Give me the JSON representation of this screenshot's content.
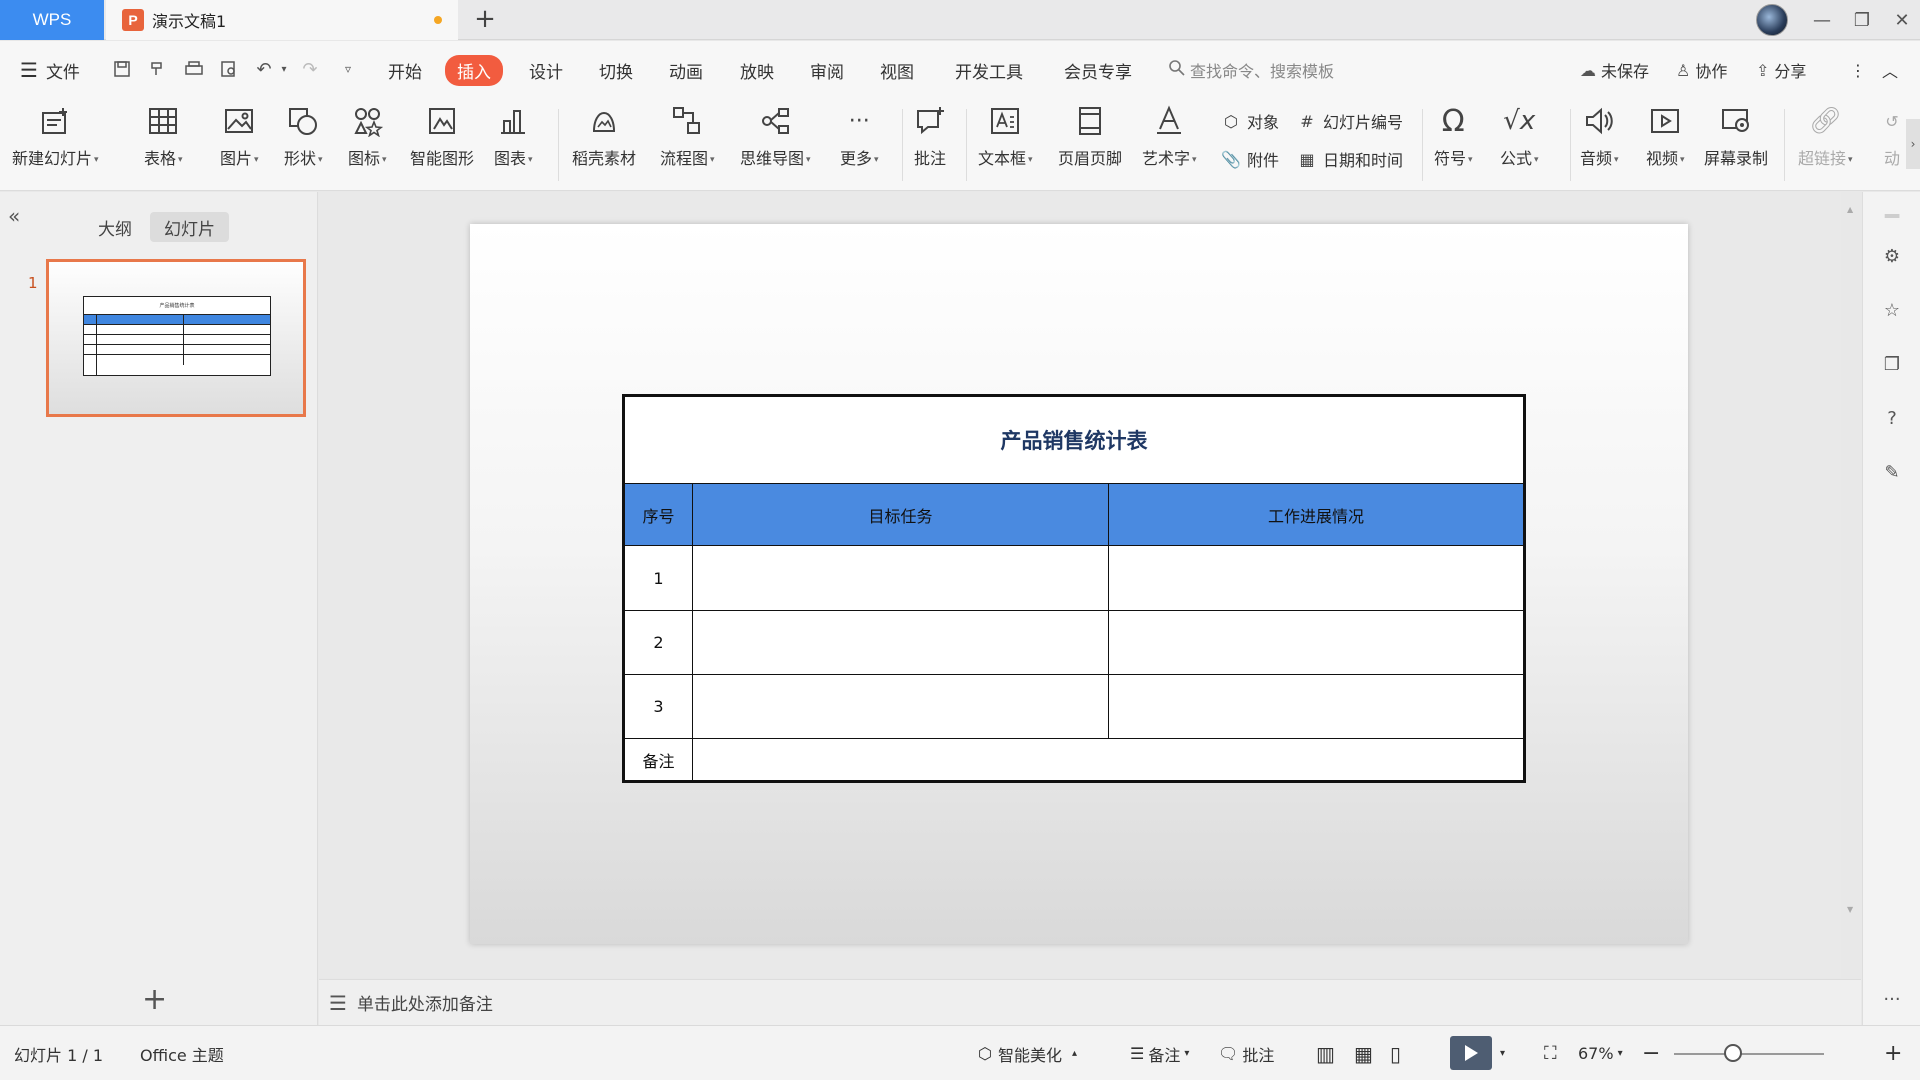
{
  "titlebar": {
    "app_label": "WPS",
    "doc_icon_letter": "P",
    "doc_title": "演示文稿1",
    "new_tab": "+"
  },
  "menu": {
    "file": "文件",
    "tabs": [
      "开始",
      "插入",
      "设计",
      "切换",
      "动画",
      "放映",
      "审阅",
      "视图",
      "开发工具",
      "会员专享"
    ],
    "active_tab": "插入",
    "search_placeholder": "查找命令、搜索模板",
    "unsaved": "未保存",
    "collab": "协作",
    "share": "分享"
  },
  "ribbon": {
    "new_slide": "新建幻灯片",
    "table": "表格",
    "picture": "图片",
    "shape": "形状",
    "icon": "图标",
    "smartart": "智能图形",
    "chart": "图表",
    "docer": "稻壳素材",
    "flowchart": "流程图",
    "mindmap": "思维导图",
    "more": "更多",
    "comment": "批注",
    "textbox": "文本框",
    "header_footer": "页眉页脚",
    "wordart": "艺术字",
    "object": "对象",
    "attachment": "附件",
    "slide_number": "幻灯片编号",
    "datetime": "日期和时间",
    "symbol": "符号",
    "formula": "公式",
    "audio": "音频",
    "video": "视频",
    "screen_record": "屏幕录制",
    "hyperlink": "超链接",
    "action": "动"
  },
  "left_panel": {
    "tab_outline": "大纲",
    "tab_slides": "幻灯片",
    "slide_number": "1",
    "thumb_title": "产品销售统计表",
    "add": "+"
  },
  "slide": {
    "table_title": "产品销售统计表",
    "headers": [
      "序号",
      "目标任务",
      "工作进展情况"
    ],
    "rows": [
      "1",
      "2",
      "3"
    ],
    "remark": "备注",
    "header_color": "#4a8ae0"
  },
  "notes": {
    "placeholder": "单击此处添加备注"
  },
  "status": {
    "slide_info": "幻灯片 1 / 1",
    "theme": "Office 主题",
    "beautify": "智能美化",
    "notes": "备注",
    "comments": "批注",
    "zoom": "67%"
  },
  "colors": {
    "wps_blue": "#3c8cf0",
    "active_tab": "#f25c3f",
    "thumb_border": "#e8784a"
  }
}
